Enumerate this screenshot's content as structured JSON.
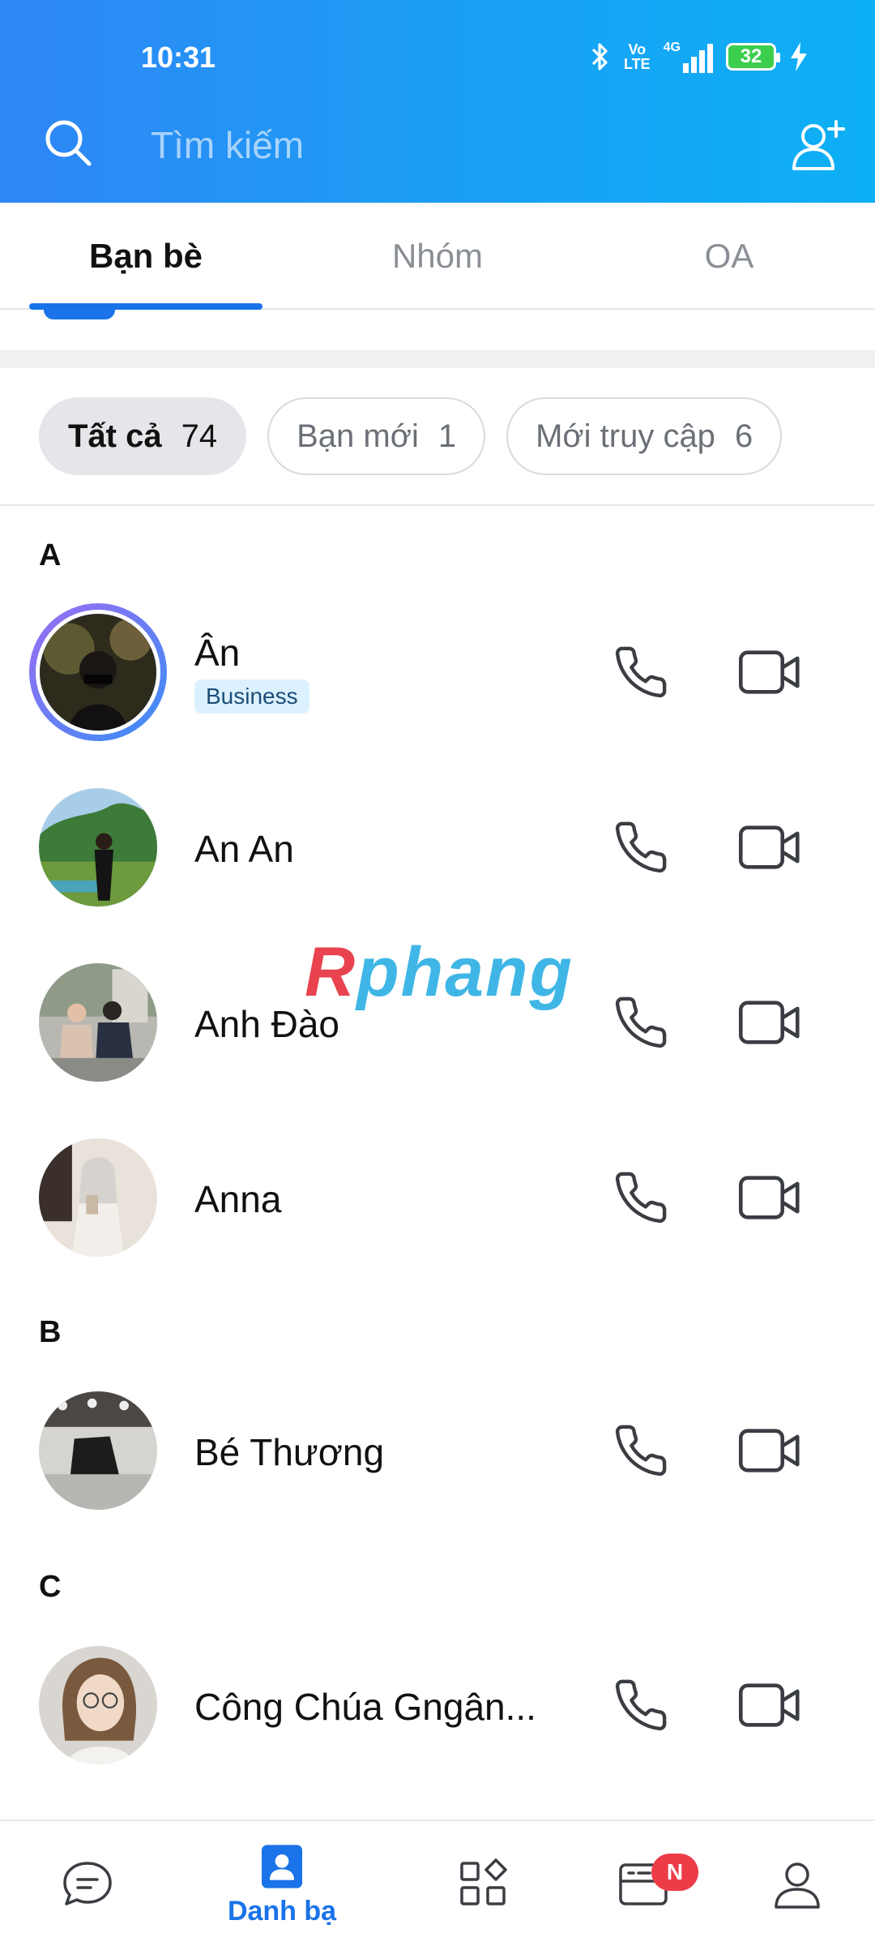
{
  "status_bar": {
    "time": "10:31",
    "volte_top": "Vo",
    "volte_bottom": "LTE",
    "network": "4G",
    "battery": "32"
  },
  "search": {
    "placeholder": "Tìm kiếm"
  },
  "tabs": [
    {
      "label": "Bạn bè",
      "active": true
    },
    {
      "label": "Nhóm",
      "active": false
    },
    {
      "label": "OA",
      "active": false
    }
  ],
  "filters": [
    {
      "label": "Tất cả",
      "count": "74",
      "active": true
    },
    {
      "label": "Bạn mới",
      "count": "1",
      "active": false
    },
    {
      "label": "Mới truy cập",
      "count": "6",
      "active": false
    }
  ],
  "sections": [
    {
      "letter": "A"
    },
    {
      "letter": "B"
    },
    {
      "letter": "C"
    }
  ],
  "contacts": [
    {
      "name": "Ân",
      "badge": "Business"
    },
    {
      "name": "An An"
    },
    {
      "name": "Anh Đào"
    },
    {
      "name": "Anna"
    },
    {
      "name": "Bé Thương"
    },
    {
      "name": "Công Chúa Gngân..."
    }
  ],
  "watermark": {
    "part1": "R",
    "part2": "phang"
  },
  "bottom_nav": {
    "contacts_label": "Danh bạ",
    "news_badge": "N"
  },
  "colors": {
    "header_start": "#2f86f5",
    "header_end": "#0db0f5",
    "accent": "#1a73e8",
    "badge_red": "#ee3b48"
  }
}
